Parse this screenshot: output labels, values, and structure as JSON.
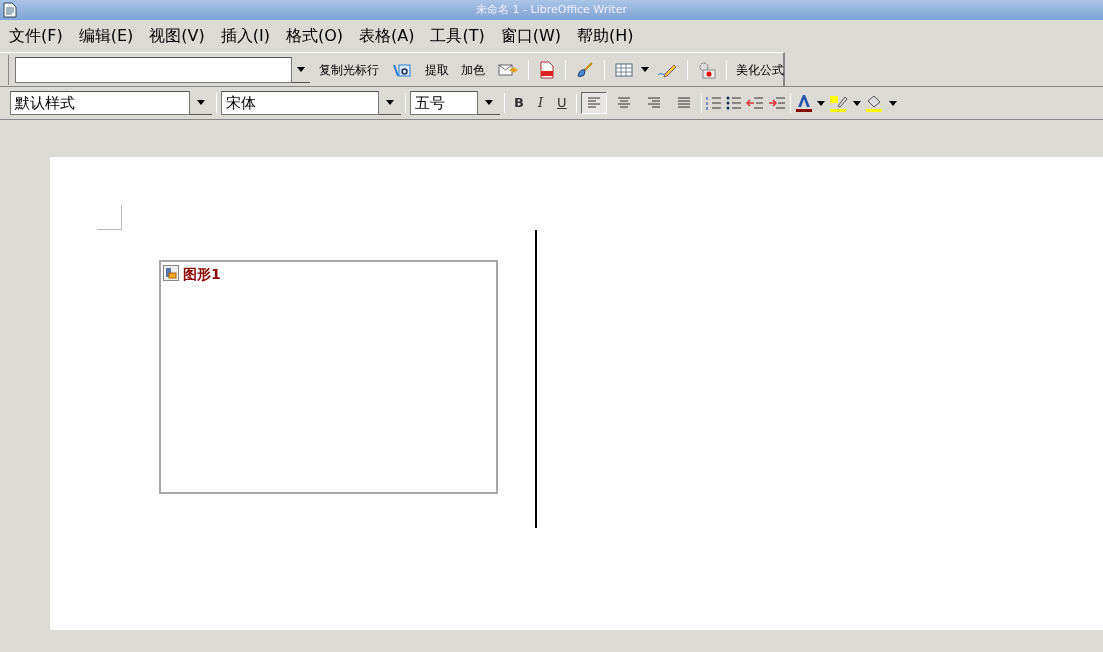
{
  "window": {
    "title": "未命名 1 - LibreOffice Writer"
  },
  "menu": [
    {
      "label": "文件(F)"
    },
    {
      "label": "编辑(E)"
    },
    {
      "label": "视图(V)"
    },
    {
      "label": "插入(I)"
    },
    {
      "label": "格式(O)"
    },
    {
      "label": "表格(A)"
    },
    {
      "label": "工具(T)"
    },
    {
      "label": "窗口(W)"
    },
    {
      "label": "帮助(H)"
    }
  ],
  "toolbar": {
    "items": [
      {
        "kind": "combo"
      },
      {
        "kind": "text",
        "label": "复制光标行"
      },
      {
        "kind": "icon"
      },
      {
        "kind": "text",
        "label": "提取"
      },
      {
        "kind": "text",
        "label": "加色"
      },
      {
        "kind": "icon"
      },
      {
        "kind": "sep"
      },
      {
        "kind": "icon"
      },
      {
        "kind": "sep"
      },
      {
        "kind": "icon"
      },
      {
        "kind": "sep"
      },
      {
        "kind": "icon"
      },
      {
        "kind": "caret"
      },
      {
        "kind": "icon"
      },
      {
        "kind": "sep"
      },
      {
        "kind": "icon"
      },
      {
        "kind": "sep"
      },
      {
        "kind": "text",
        "label": "美化公式"
      }
    ]
  },
  "formatting": {
    "style": "默认样式",
    "font": "宋体",
    "size": "五号",
    "text_styles": [
      {
        "label": "B"
      },
      {
        "label": "I"
      },
      {
        "label": "U"
      }
    ],
    "alignment": [
      {
        "selected": true
      },
      {
        "selected": false
      },
      {
        "selected": false
      },
      {
        "selected": false
      }
    ]
  },
  "document": {
    "frame": {
      "name": "图形1"
    }
  }
}
